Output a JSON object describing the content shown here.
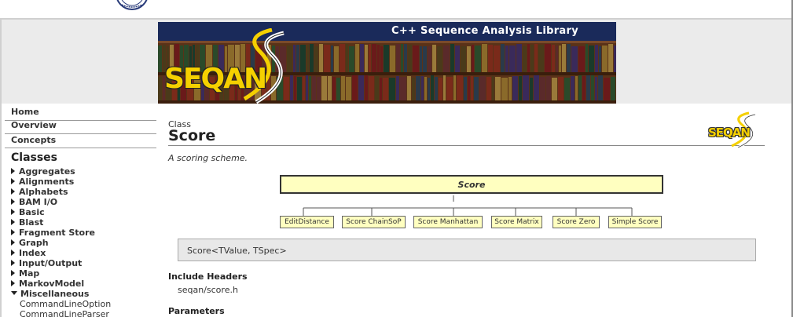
{
  "banner": {
    "title": "C++ Sequence Analysis Library",
    "logo_text": "SEQAN"
  },
  "sidebar": {
    "nav": [
      {
        "label": "Home"
      },
      {
        "label": "Overview"
      },
      {
        "label": "Concepts"
      }
    ],
    "classes_heading": "Classes",
    "categories": [
      {
        "label": "Aggregates",
        "expanded": false
      },
      {
        "label": "Alignments",
        "expanded": false
      },
      {
        "label": "Alphabets",
        "expanded": false
      },
      {
        "label": "BAM I/O",
        "expanded": false
      },
      {
        "label": "Basic",
        "expanded": false
      },
      {
        "label": "Blast",
        "expanded": false
      },
      {
        "label": "Fragment Store",
        "expanded": false
      },
      {
        "label": "Graph",
        "expanded": false
      },
      {
        "label": "Index",
        "expanded": false
      },
      {
        "label": "Input/Output",
        "expanded": false
      },
      {
        "label": "Map",
        "expanded": false
      },
      {
        "label": "MarkovModel",
        "expanded": false
      },
      {
        "label": "Miscellaneous",
        "expanded": true
      }
    ],
    "sub_items": [
      {
        "label": "CommandLineOption"
      },
      {
        "label": "CommandLineParser"
      }
    ]
  },
  "main": {
    "kind": "Class",
    "title": "Score",
    "logo_text": "SEQAN",
    "summary": "A scoring scheme.",
    "diagram": {
      "root": "Score",
      "children": [
        "EditDistance",
        "Score ChainSoP",
        "Score Manhattan",
        "Score Matrix",
        "Score Zero",
        "Simple Score"
      ]
    },
    "signature": "Score<TValue, TSpec>",
    "include_heading": "Include Headers",
    "include_value": "seqan/score.h",
    "params_heading": "Parameters"
  },
  "colors": {
    "banner_bar": "#1a2a5a",
    "logo_yellow": "#f5d000",
    "diagram_box": "#ffffc0",
    "signature_bg": "#e8e8e8"
  }
}
